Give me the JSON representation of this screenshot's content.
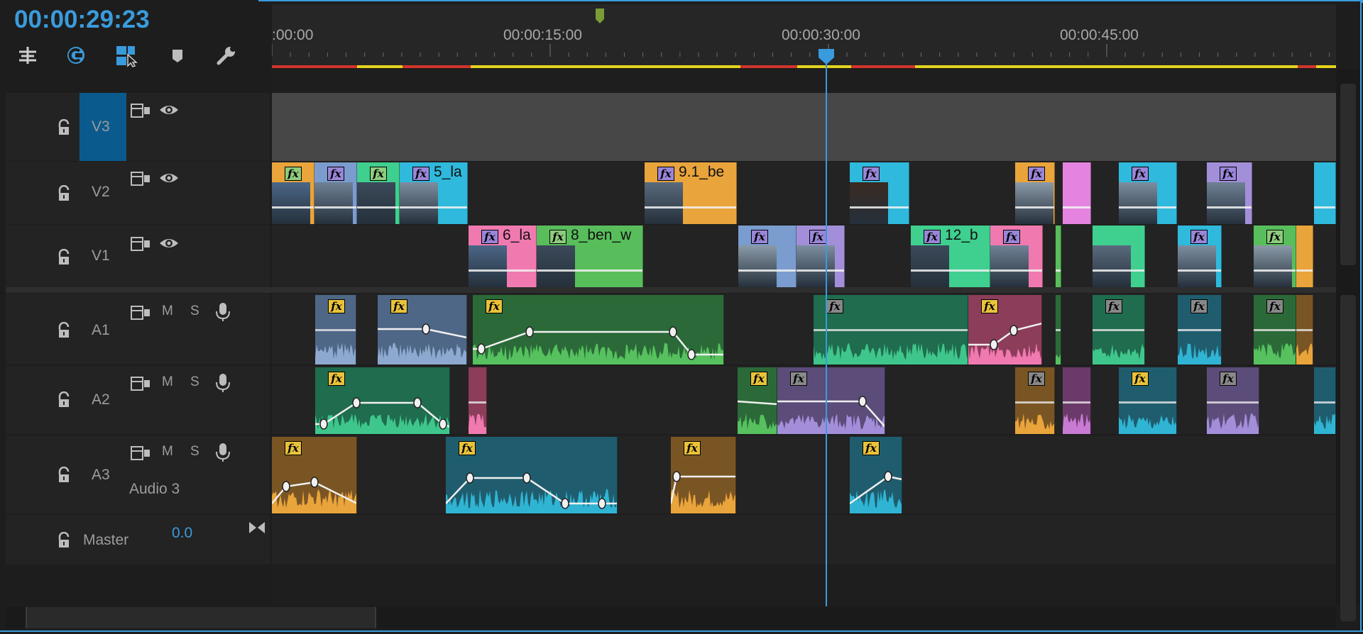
{
  "timecode": "00:00:29:23",
  "ruler": {
    "labels": [
      ":00:00",
      "00:00:15:00",
      "00:00:30:00",
      "00:00:45:00"
    ]
  },
  "tools": [
    "snap-icon",
    "linked-selection-icon",
    "selection-tool-icon",
    "marker-icon",
    "wrench-icon"
  ],
  "tracks": {
    "v3": {
      "lock": "lock-icon",
      "label": "V3"
    },
    "v2": {
      "lock": "lock-icon",
      "label": "V2"
    },
    "v1": {
      "lock": "lock-icon",
      "label": "V1"
    },
    "a1": {
      "lock": "lock-icon",
      "label": "A1",
      "m": "M",
      "s": "S"
    },
    "a2": {
      "lock": "lock-icon",
      "label": "A2",
      "m": "M",
      "s": "S"
    },
    "a3": {
      "lock": "lock-icon",
      "label": "A3",
      "m": "M",
      "s": "S",
      "name": "Audio 3"
    },
    "master": {
      "lock": "lock-icon",
      "label": "Master",
      "value": "0.0"
    }
  },
  "clips": {
    "v2_5": "5_la",
    "v2_91": "9.1_be",
    "v1_6": "6_la",
    "v1_8": "8_ben_w",
    "v1_12": "12_b"
  },
  "fx_label": "fx",
  "colors": {
    "accent": "#3a9bdc",
    "orange": "#e9a43b",
    "blue": "#7a9ccf",
    "green": "#3fcf8e",
    "cyan": "#2fb9dc",
    "pink": "#f07ab0",
    "lavender": "#a38fd9",
    "purple_pink": "#e484e0",
    "green2": "#58bd5b"
  }
}
